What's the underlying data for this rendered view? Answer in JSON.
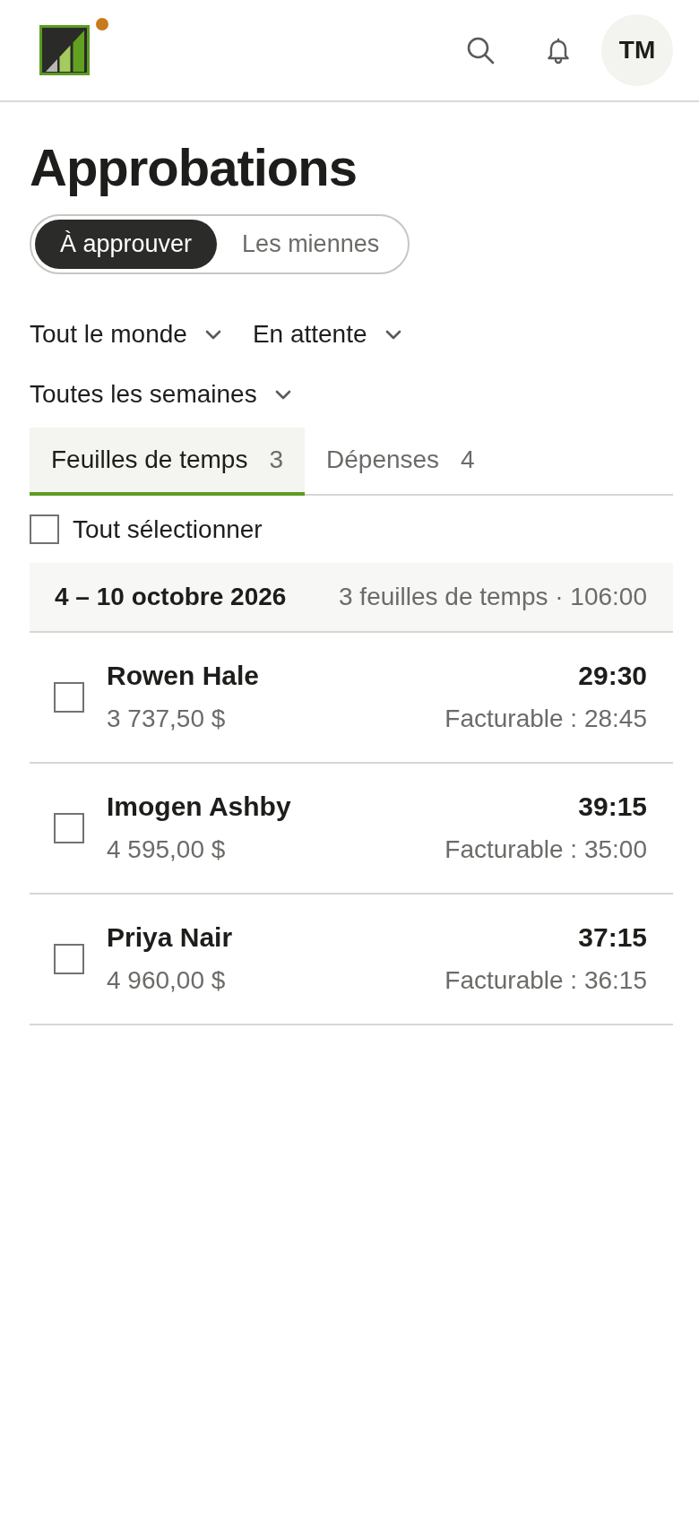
{
  "logo": {
    "badge": true
  },
  "avatar": {
    "initials": "TM"
  },
  "page": {
    "title": "Approbations"
  },
  "segments": [
    {
      "label": "À approuver",
      "selected": true
    },
    {
      "label": "Les miennes",
      "selected": false
    }
  ],
  "filters": [
    {
      "label": "Tout le monde"
    },
    {
      "label": "En attente"
    },
    {
      "label": "Toutes les semaines"
    }
  ],
  "tabs": [
    {
      "label": "Feuilles de temps",
      "count": "3",
      "selected": true
    },
    {
      "label": "Dépenses",
      "count": "4",
      "selected": false
    }
  ],
  "select_all": {
    "label": "Tout sélectionner",
    "checked": false
  },
  "groups": [
    {
      "title": "4 – 10 octobre 2026",
      "summary": "3 feuilles de temps · 106:00",
      "rows": [
        {
          "name": "Rowen Hale",
          "amount": "3 737,50 $",
          "hours": "29:30",
          "billable": "Facturable : 28:45",
          "checked": false
        },
        {
          "name": "Imogen Ashby",
          "amount": "4 595,00 $",
          "hours": "39:15",
          "billable": "Facturable : 35:00",
          "checked": false
        },
        {
          "name": "Priya Nair",
          "amount": "4 960,00 $",
          "hours": "37:15",
          "billable": "Facturable : 36:15",
          "checked": false
        }
      ]
    }
  ]
}
